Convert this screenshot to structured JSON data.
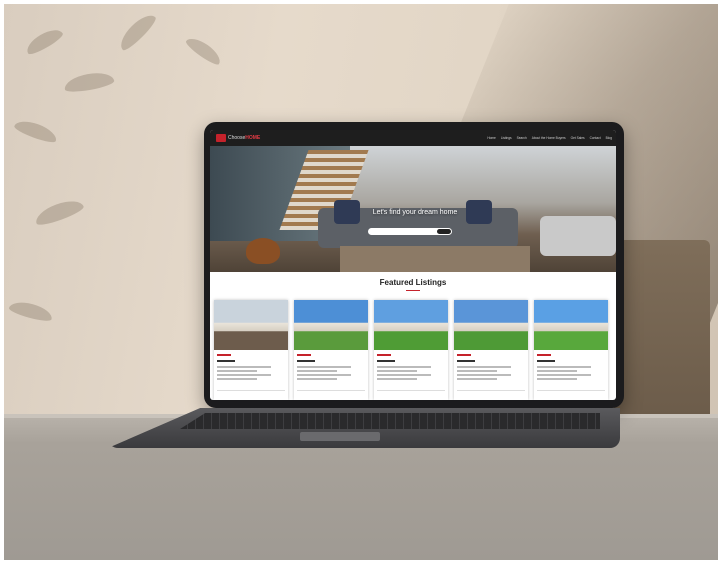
{
  "site": {
    "logo_text_left": "Choose",
    "logo_text_right": "HOME",
    "nav_links": [
      "Home",
      "Listings",
      "Search",
      "About the Home Buyers",
      "Get Sales",
      "Contact",
      "Blog"
    ]
  },
  "hero": {
    "title": "Let's find your dream home",
    "search_placeholder": "",
    "search_button": ""
  },
  "featured": {
    "title": "Featured Listings",
    "cards": [
      {
        "photo": "interior-living-room",
        "color_top": "#c9d3dc",
        "color_bottom": "#6d5c4c"
      },
      {
        "photo": "two-story-house",
        "color_top": "#4d8fd6",
        "color_bottom": "#5a9b3c"
      },
      {
        "photo": "colonial-house",
        "color_top": "#5f9fe0",
        "color_bottom": "#4f9c35"
      },
      {
        "photo": "brick-house",
        "color_top": "#5a95d8",
        "color_bottom": "#4e9a36"
      },
      {
        "photo": "ranch-house",
        "color_top": "#5aa0e4",
        "color_bottom": "#58a83c"
      }
    ]
  },
  "colors": {
    "accent": "#c5222b",
    "nav_bg": "#1e1e1e"
  }
}
